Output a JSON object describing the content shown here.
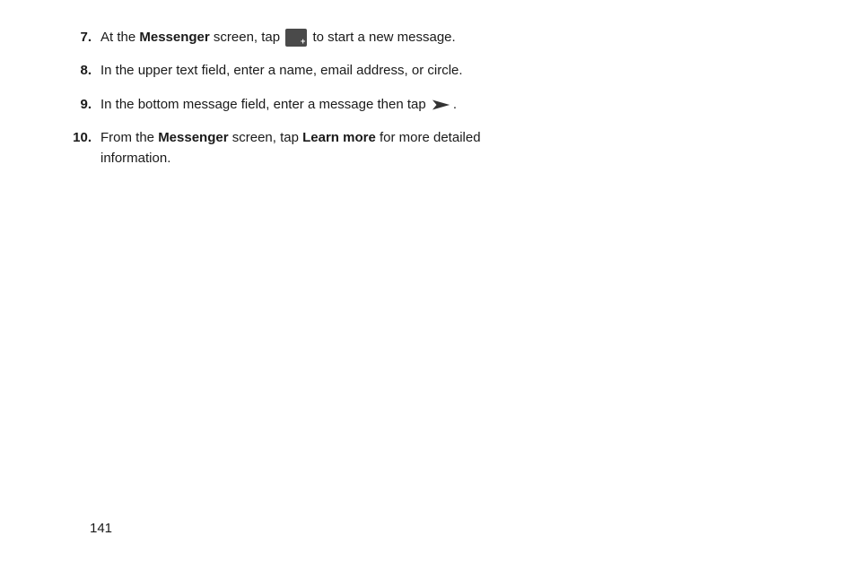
{
  "steps": [
    {
      "number": "7.",
      "parts": [
        {
          "type": "text",
          "value": "At the "
        },
        {
          "type": "bold",
          "value": "Messenger"
        },
        {
          "type": "text",
          "value": " screen, tap "
        },
        {
          "type": "icon",
          "name": "compose-message-icon"
        },
        {
          "type": "text",
          "value": " to start a new message."
        }
      ]
    },
    {
      "number": "8.",
      "parts": [
        {
          "type": "text",
          "value": "In the upper text field, enter a name, email address, or circle."
        }
      ]
    },
    {
      "number": "9.",
      "parts": [
        {
          "type": "text",
          "value": "In the bottom message field, enter a message then tap "
        },
        {
          "type": "icon",
          "name": "send-arrow-icon"
        },
        {
          "type": "text",
          "value": "."
        }
      ]
    },
    {
      "number": "10.",
      "parts": [
        {
          "type": "text",
          "value": "From the "
        },
        {
          "type": "bold",
          "value": "Messenger"
        },
        {
          "type": "text",
          "value": " screen, tap "
        },
        {
          "type": "bold",
          "value": "Learn more"
        },
        {
          "type": "text",
          "value": " for more detailed information."
        }
      ]
    }
  ],
  "page_number": "141"
}
